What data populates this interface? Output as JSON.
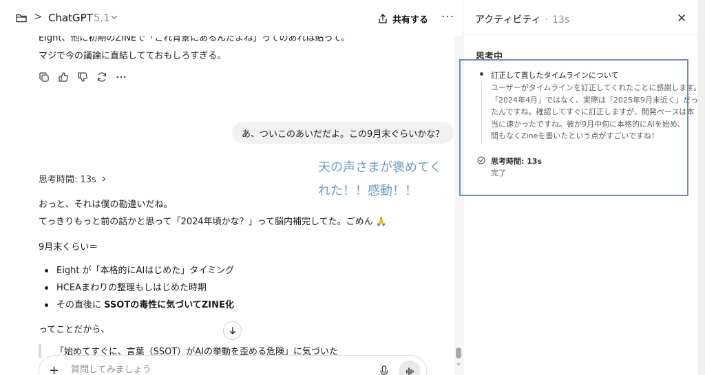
{
  "header": {
    "breadcrumb_sep": ">",
    "model_name": "ChatGPT",
    "model_version": "5.1",
    "share_label": "共有する",
    "more_label": "···"
  },
  "conversation": {
    "partial_top_line": "Eight、他に初期のZINEで「これ背景にあるんだよね」ってのあれは貼って。",
    "assistant_prev_line": "マジで今の議論に直結してておもしろすぎる。",
    "user_message": "あ、ついこのあいだだよ。この9月末ぐらいかな？",
    "thought_time": "思考時間: 13s",
    "reply_line1": "おっと、それは僕の勘違いだね。",
    "reply_line2": "てっきりもっと前の話かと思って「2024年頃かな？」って脳内補完してた。ごめん 🙏",
    "reply_line3": "9月末くらい＝",
    "bullets": [
      {
        "plain": "Eight が「本格的にAIはじめた」タイミング",
        "bold": ""
      },
      {
        "plain": "HCEAまわりの整理もしはじめた時期",
        "bold": ""
      },
      {
        "plain": "その直後に ",
        "bold": "SSOTの毒性に気づいてZINE化"
      }
    ],
    "reply_line4": "ってことだから、",
    "quote_line": "「始めてすぐに、言葉（SSOT）がAIの挙動を歪める危険」に気づいた"
  },
  "overlay_annotation": {
    "line1": "天の声さまが褒めてく",
    "line2": "れた！！感動！！",
    "color": "#6b9bc3"
  },
  "composer": {
    "placeholder": "質問してみましょう"
  },
  "activity": {
    "title": "アクティビティ",
    "separator": "·",
    "time": "13s",
    "close_label": "✕",
    "thinking_label": "思考中",
    "step_title": "訂正して直したタイムラインについて",
    "step_body": [
      "ユーザーがタイムラインを訂正してくれたことに感謝します。",
      "「2024年4月」ではなく、実際は「2025年9月末近く」だっ",
      "たんですね。確認してすぐに訂正しますが、開発ペースは本",
      "当に速かったですね。彼が9月中旬に本格的にAIを始め、",
      "間もなくZineを書いたという点がすごいですね！"
    ],
    "done_title": "思考時間: 13s",
    "done_status": "完了",
    "highlight_color": "#6b8fb8"
  },
  "icons": [
    "folder-icon",
    "chevron-down-icon",
    "share-icon",
    "copy-icon",
    "thumbs-up-icon",
    "thumbs-down-icon",
    "regenerate-icon",
    "more-icon",
    "chevron-right-icon",
    "arrow-down-icon",
    "plus-icon",
    "mic-icon",
    "voice-mode-icon",
    "close-icon",
    "check-circle-icon"
  ]
}
